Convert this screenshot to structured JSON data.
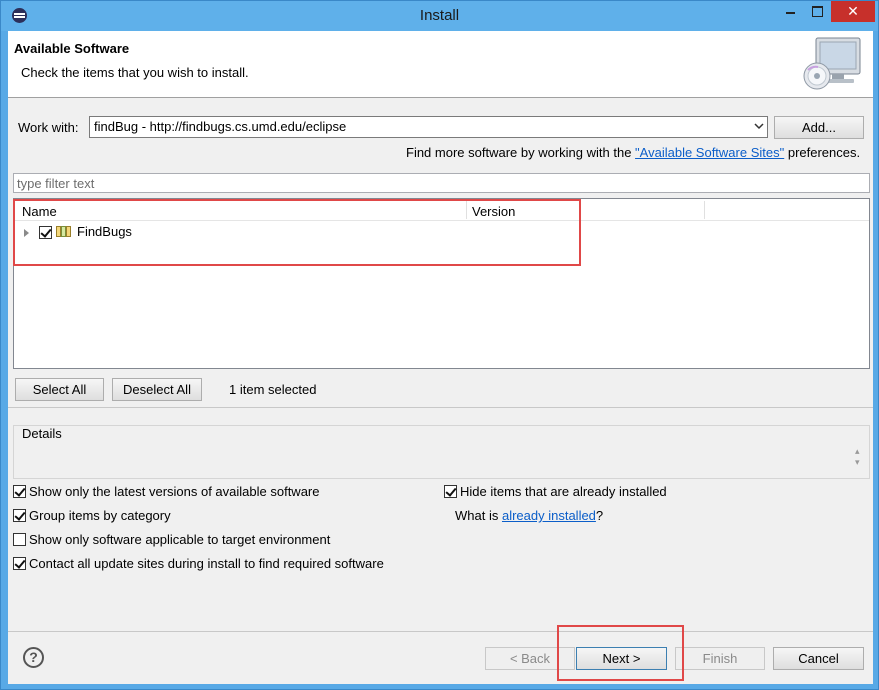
{
  "window": {
    "title": "Install"
  },
  "header": {
    "title": "Available Software",
    "description": "Check the items that you wish to install."
  },
  "work_with": {
    "label": "Work with:",
    "value": "findBug - http://findbugs.cs.umd.edu/eclipse",
    "add_button": "Add...",
    "hint_prefix": "Find more software by working with the ",
    "hint_link": "\"Available Software Sites\"",
    "hint_suffix": " preferences."
  },
  "filter": {
    "placeholder": "type filter text"
  },
  "tree": {
    "columns": [
      "Name",
      "Version"
    ],
    "items": [
      {
        "name": "FindBugs",
        "version": "",
        "checked": true
      }
    ]
  },
  "selection": {
    "select_all": "Select All",
    "deselect_all": "Deselect All",
    "status": "1 item selected"
  },
  "details": {
    "title": "Details"
  },
  "options": [
    {
      "label": "Show only the latest versions of available software",
      "checked": true
    },
    {
      "label": "Group items by category",
      "checked": true
    },
    {
      "label": "Show only software applicable to target environment",
      "checked": false
    },
    {
      "label": "Contact all update sites during install to find required software",
      "checked": true
    }
  ],
  "right_options": {
    "hide_installed": {
      "label": "Hide items that are already installed",
      "checked": true
    },
    "what_is_prefix": "What is ",
    "what_is_link": "already installed",
    "what_is_suffix": "?"
  },
  "buttons": {
    "back": "< Back",
    "next": "Next >",
    "finish": "Finish",
    "cancel": "Cancel"
  },
  "colors": {
    "highlight": "#e04848",
    "link": "#0b5ec9",
    "titlebar": "#5fb0ea",
    "close": "#c7302b"
  }
}
